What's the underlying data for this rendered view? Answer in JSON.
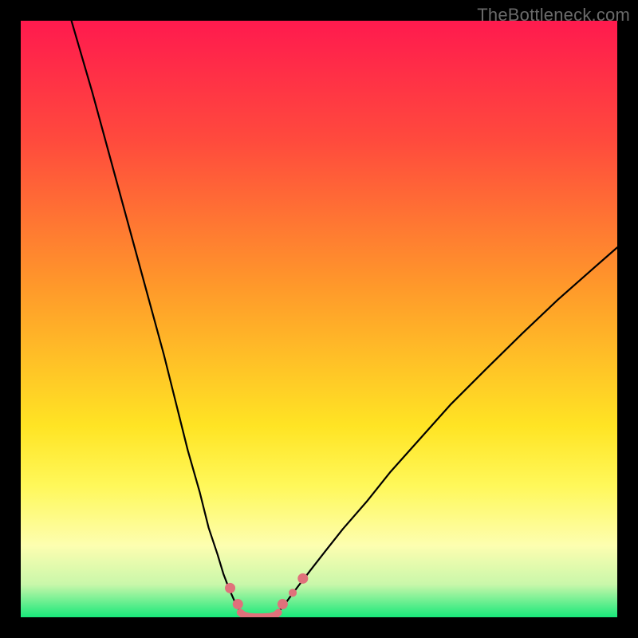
{
  "watermark": {
    "text": "TheBottleneck.com"
  },
  "chart_data": {
    "type": "line",
    "title": "",
    "xlabel": "",
    "ylabel": "",
    "xlim": [
      0,
      100
    ],
    "ylim": [
      0,
      100
    ],
    "grid": false,
    "legend": false,
    "background_gradient": {
      "stops": [
        {
          "offset": 0.0,
          "color": "#ff1a4e"
        },
        {
          "offset": 0.2,
          "color": "#ff4a3d"
        },
        {
          "offset": 0.45,
          "color": "#ff9a2a"
        },
        {
          "offset": 0.68,
          "color": "#ffe424"
        },
        {
          "offset": 0.78,
          "color": "#fff85a"
        },
        {
          "offset": 0.88,
          "color": "#fdfeb0"
        },
        {
          "offset": 0.945,
          "color": "#c9f7aa"
        },
        {
          "offset": 1.0,
          "color": "#18e87a"
        }
      ]
    },
    "series": [
      {
        "name": "left-curve",
        "color": "#000000",
        "width": 2.2,
        "x": [
          8.5,
          12,
          15,
          18,
          21,
          24,
          26,
          28,
          30,
          31.5,
          33,
          34,
          35,
          35.8,
          36.4,
          36.9,
          37.3
        ],
        "y": [
          100,
          88,
          77,
          66,
          55,
          44,
          36,
          28,
          21,
          15,
          10.5,
          7.2,
          4.6,
          2.8,
          1.6,
          0.8,
          0.3
        ]
      },
      {
        "name": "right-curve",
        "color": "#000000",
        "width": 2.2,
        "x": [
          42.6,
          43.1,
          43.9,
          45,
          46.5,
          48.5,
          51,
          54,
          58,
          62,
          67,
          72,
          78,
          84,
          90,
          96,
          100
        ],
        "y": [
          0.3,
          0.8,
          1.7,
          3.2,
          5.2,
          7.8,
          11,
          14.8,
          19.4,
          24.4,
          30,
          35.6,
          41.6,
          47.5,
          53.2,
          58.5,
          62
        ]
      },
      {
        "name": "bottom-segment",
        "color": "#e0717b",
        "width": 9,
        "x": [
          36.8,
          37.4,
          38.2,
          39.2,
          40.5,
          41.8,
          42.7,
          43.2
        ],
        "y": [
          0.8,
          0.35,
          0.12,
          0.05,
          0.05,
          0.12,
          0.35,
          0.8
        ]
      }
    ],
    "markers": [
      {
        "x": 35.1,
        "y": 4.9,
        "r": 6.5,
        "color": "#e0717b"
      },
      {
        "x": 36.4,
        "y": 2.2,
        "r": 6.5,
        "color": "#e0717b"
      },
      {
        "x": 43.9,
        "y": 2.2,
        "r": 6.5,
        "color": "#e0717b"
      },
      {
        "x": 45.6,
        "y": 4.1,
        "r": 5.0,
        "color": "#e0717b"
      },
      {
        "x": 47.3,
        "y": 6.5,
        "r": 6.5,
        "color": "#e0717b"
      }
    ]
  }
}
